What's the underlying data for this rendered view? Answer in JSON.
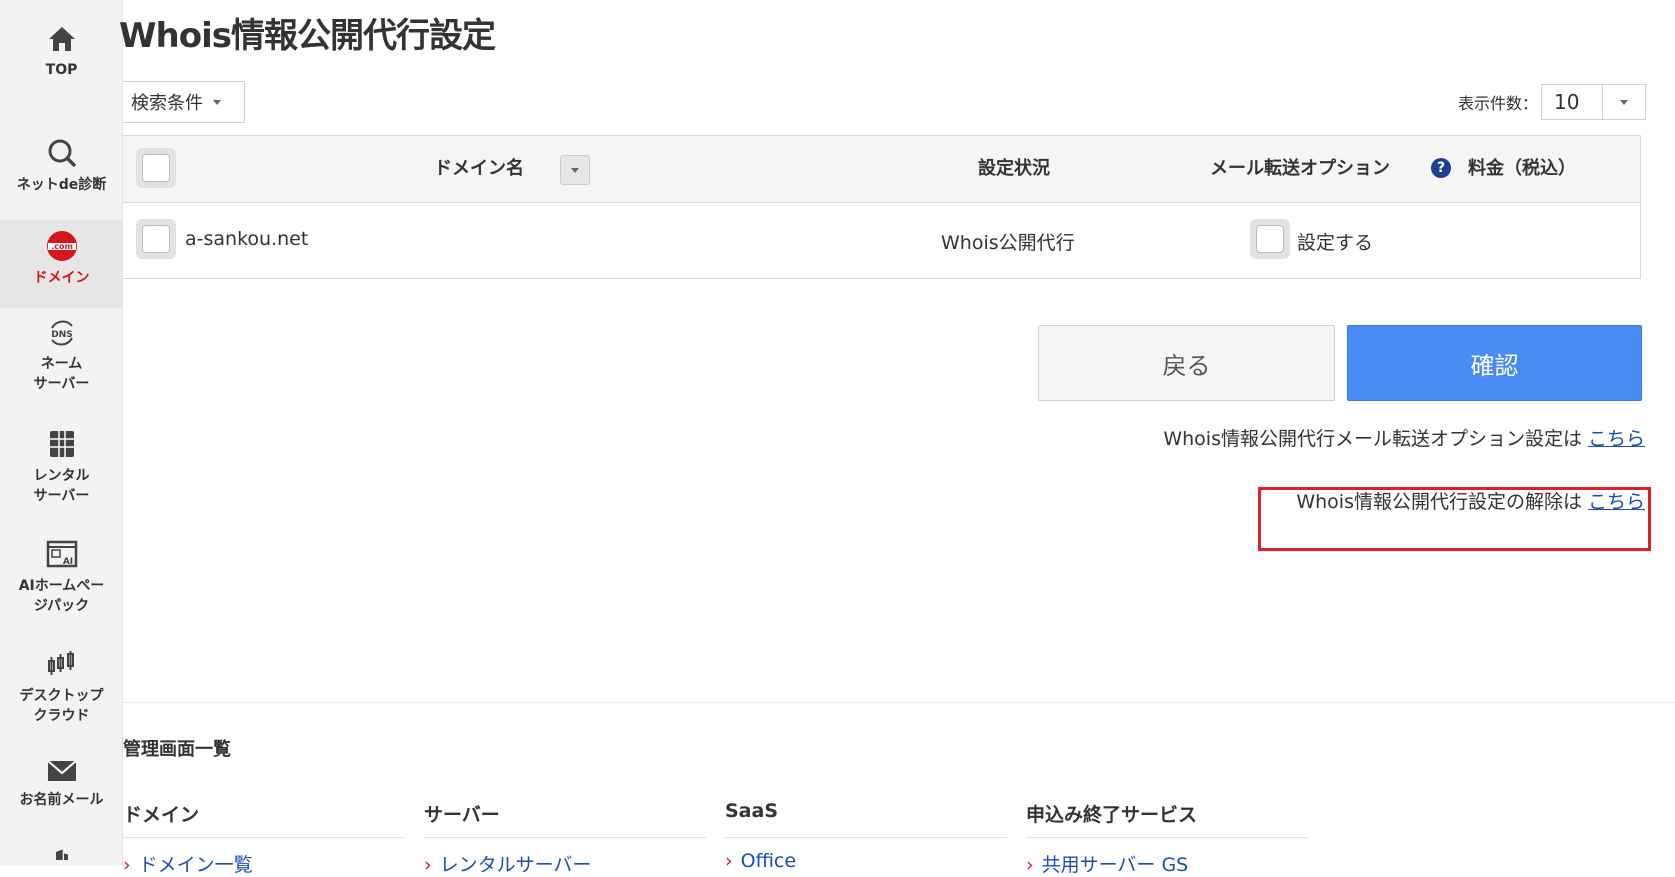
{
  "sidebar": {
    "items": [
      {
        "label": "TOP",
        "icon": "home-icon"
      },
      {
        "label": "ネットde診断",
        "icon": "search-icon"
      },
      {
        "label": "ドメイン",
        "icon": "dotcom-icon",
        "active": true
      },
      {
        "label_line1": "ネーム",
        "label_line2": "サーバー",
        "icon": "dns-icon"
      },
      {
        "label_line1": "レンタル",
        "label_line2": "サーバー",
        "icon": "server-icon"
      },
      {
        "label_line1": "AIホームペー",
        "label_line2": "ジパック",
        "icon": "ai-homepage-icon"
      },
      {
        "label_line1": "デスクトップ",
        "label_line2": "クラウド",
        "icon": "desktop-cloud-icon"
      },
      {
        "label": "お名前メール",
        "icon": "mail-icon"
      }
    ]
  },
  "page": {
    "title": "Whois情報公開代行設定",
    "filter_label": "検索条件",
    "per_page_label": "表示件数：",
    "per_page_value": "10"
  },
  "table": {
    "headers": {
      "domain": "ドメイン名",
      "status": "設定状況",
      "mail_option": "メール転送オプション",
      "price": "料金（税込）"
    },
    "rows": [
      {
        "domain": "a-sankou.net",
        "status": "Whois公開代行",
        "mail_option_label": "設定する"
      }
    ]
  },
  "actions": {
    "back": "戻る",
    "confirm": "確認"
  },
  "links": {
    "mail_option_text": "Whois情報公開代行メール転送オプション設定は",
    "mail_option_link": "こちら",
    "cancel_text": "Whois情報公開代行設定の解除は",
    "cancel_link": "こちら"
  },
  "footer": {
    "title": "管理画面一覧",
    "columns": [
      {
        "title": "ドメイン",
        "link": "ドメイン一覧"
      },
      {
        "title": "サーバー",
        "link": "レンタルサーバー"
      },
      {
        "title": "SaaS",
        "link": "Office"
      },
      {
        "title": "申込み終了サービス",
        "link": "共用サーバー GS"
      }
    ]
  },
  "colors": {
    "accent": "#d8141d",
    "primary_button": "#4a8af4",
    "link": "#1a4fb0",
    "highlight": "#e21e26"
  }
}
